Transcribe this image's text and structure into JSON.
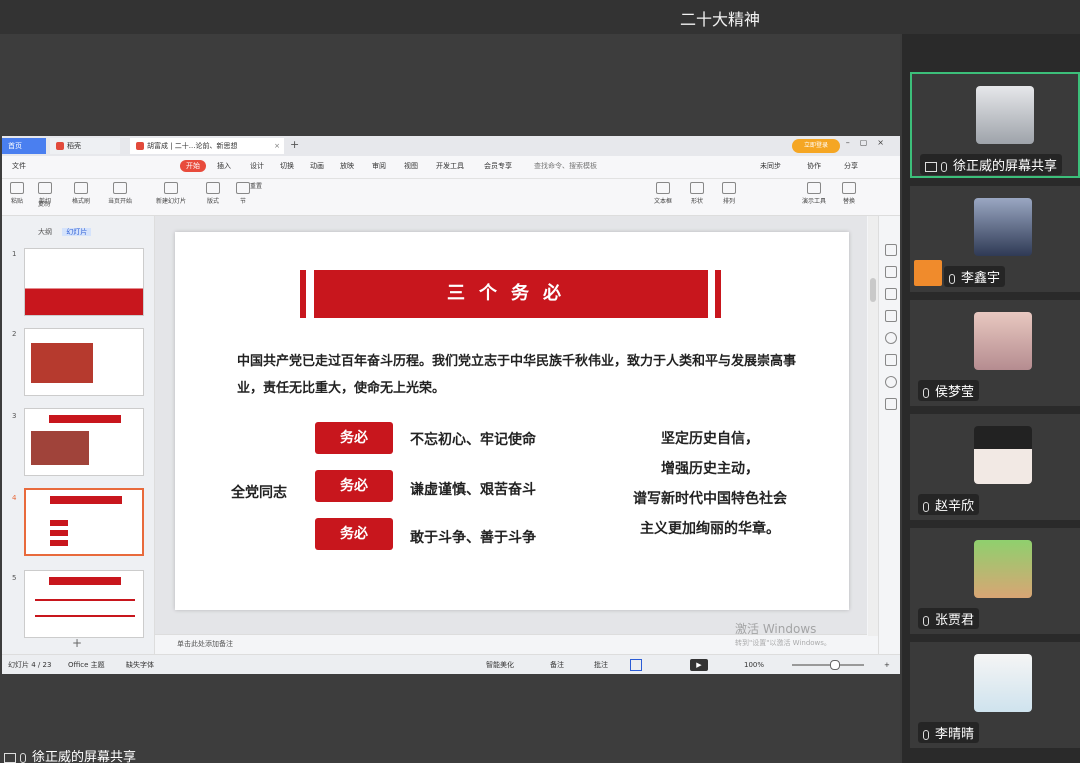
{
  "meeting": {
    "title": "二十大精神",
    "bottom_label": "徐正威的屏幕共享"
  },
  "wps": {
    "tabs": {
      "home": "首页",
      "daoke": "稻壳",
      "doc": "胡富成 | 二十...论前、新思想"
    },
    "login": "立即登录",
    "menu": [
      "文件",
      "开始",
      "插入",
      "设计",
      "切换",
      "动画",
      "放映",
      "审阅",
      "视图",
      "开发工具",
      "会员专享",
      "查找命令、搜索模板"
    ],
    "menu_right": [
      "未同步",
      "协作",
      "分享"
    ],
    "toolbar": [
      "粘贴",
      "剪切",
      "复制",
      "格式刷",
      "当页开始",
      "新建幻灯片",
      "版式",
      "节",
      "重置",
      "文本框",
      "形状",
      "排列",
      "演示工具",
      "替换"
    ],
    "thumb_tabs": {
      "outline": "大纲",
      "slides": "幻灯片"
    },
    "notes_placeholder": "单击此处添加备注",
    "status": {
      "slide_count": "幻灯片 4 / 23",
      "theme": "Office 主题",
      "font": "缺失字体",
      "beautify": "智能美化",
      "note": "备注",
      "comment": "批注",
      "zoom": "100%"
    },
    "watermark": "激活 Windows",
    "watermark_sub": "转到\"设置\"以激活 Windows。"
  },
  "slide": {
    "title": "三个务必",
    "intro": "中国共产党已走过百年奋斗历程。我们党立志于中华民族千秋伟业，致力于人类和平与发展崇高事业，责任无比重大，使命无上光荣。",
    "all_party": "全党同志",
    "musts": [
      {
        "label": "务必",
        "text": "不忘初心、牢记使命"
      },
      {
        "label": "务必",
        "text": "谦虚谨慎、艰苦奋斗"
      },
      {
        "label": "务必",
        "text": "敢于斗争、善于斗争"
      }
    ],
    "right_lines": [
      "坚定历史自信，",
      "增强历史主动，",
      "谱写新时代中国特色社会",
      "主义更加绚丽的华章。"
    ]
  },
  "participants": [
    {
      "name": "徐正威的屏幕共享",
      "color": "#c9ccd2"
    },
    {
      "name": "李鑫宇",
      "color": "#4a5a7a"
    },
    {
      "name": "侯梦莹",
      "color": "#d9b2a8"
    },
    {
      "name": "赵辛欣",
      "color": "#e8e6e6"
    },
    {
      "name": "张贾君",
      "color": "#7cbf6a"
    },
    {
      "name": "李晴晴",
      "color": "#eef2f4"
    }
  ]
}
